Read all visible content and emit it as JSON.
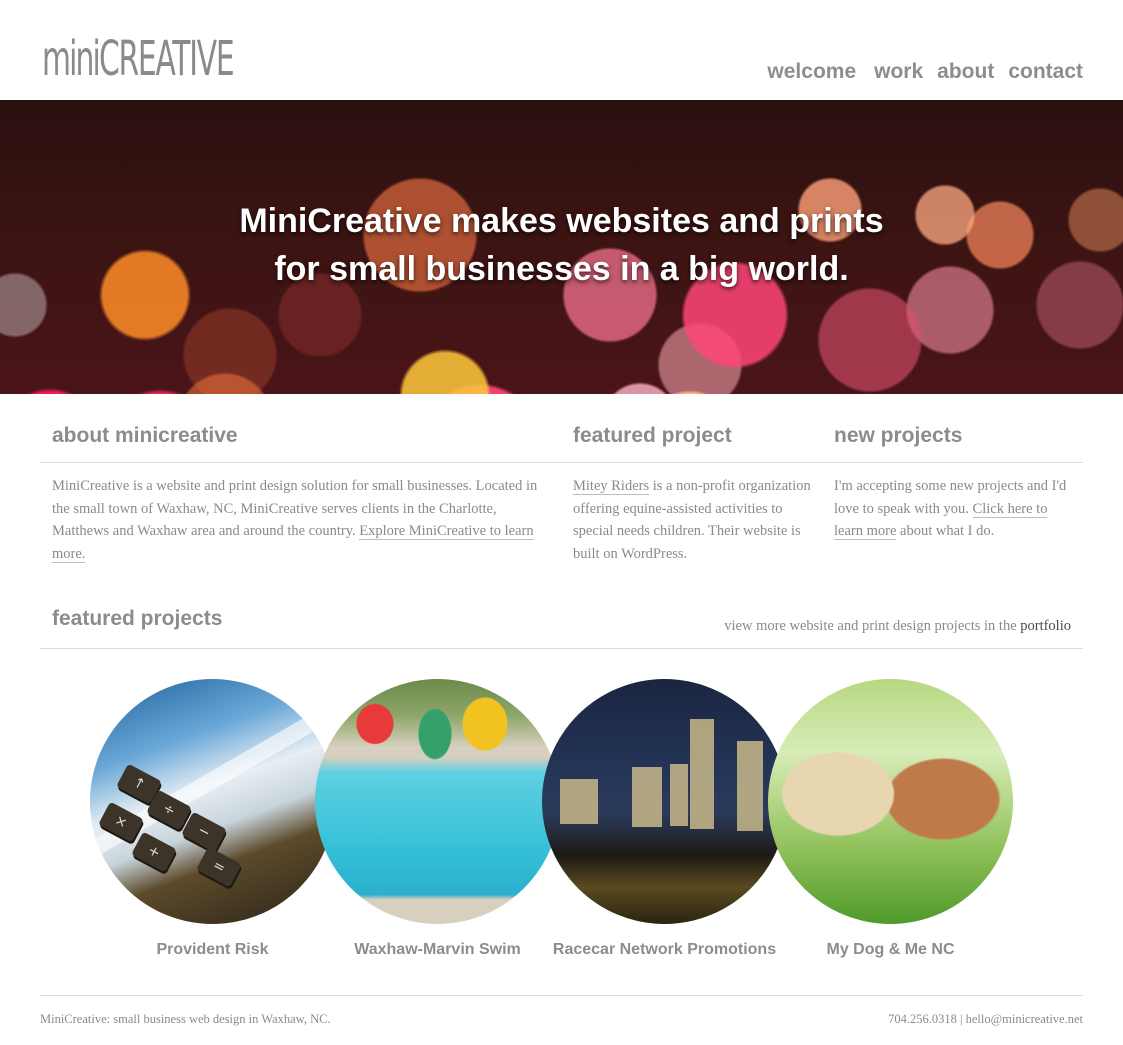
{
  "header": {
    "logo_mini": "mini",
    "logo_creative": "CREATIVE",
    "nav": [
      "welcome",
      "work",
      "about",
      "contact"
    ]
  },
  "hero": {
    "line1": "MiniCreative makes websites and prints",
    "line2": "for small businesses in a big world."
  },
  "about": {
    "heading": "about minicreative",
    "text": "MiniCreative is a website and print design solution for small businesses. Located in the small town of Waxhaw, NC, MiniCreative serves clients in the Charlotte, Matthews and Waxhaw area and around the country. ",
    "link": "Explore MiniCreative to learn more."
  },
  "featured": {
    "heading": "featured project",
    "link": "Mitey Riders",
    "text": " is a non-profit organization offering equine-assisted activities to special needs children. Their website is built on WordPress."
  },
  "new_projects": {
    "heading": "new projects",
    "text1": "I'm accepting some new projects and I'd love to speak with you. ",
    "link": "Click here to learn more",
    "text2": " about what I do."
  },
  "featured_projects": {
    "heading": "featured projects",
    "more_text": "view more website and print design projects in the ",
    "more_link": "portfolio",
    "items": [
      {
        "label": "Provident Risk"
      },
      {
        "label": "Waxhaw-Marvin Swim"
      },
      {
        "label": "Racecar Network Promotions"
      },
      {
        "label": "My Dog & Me NC"
      }
    ]
  },
  "footer": {
    "left": "MiniCreative: small business web design in Waxhaw, NC.",
    "phone": "704.256.0318",
    "separator": " | ",
    "email": "hello@minicreative.net"
  },
  "colors": {
    "text_gray": "#8a8a8a",
    "heading_gray": "#8c8c8c",
    "rule": "#dddddd"
  }
}
